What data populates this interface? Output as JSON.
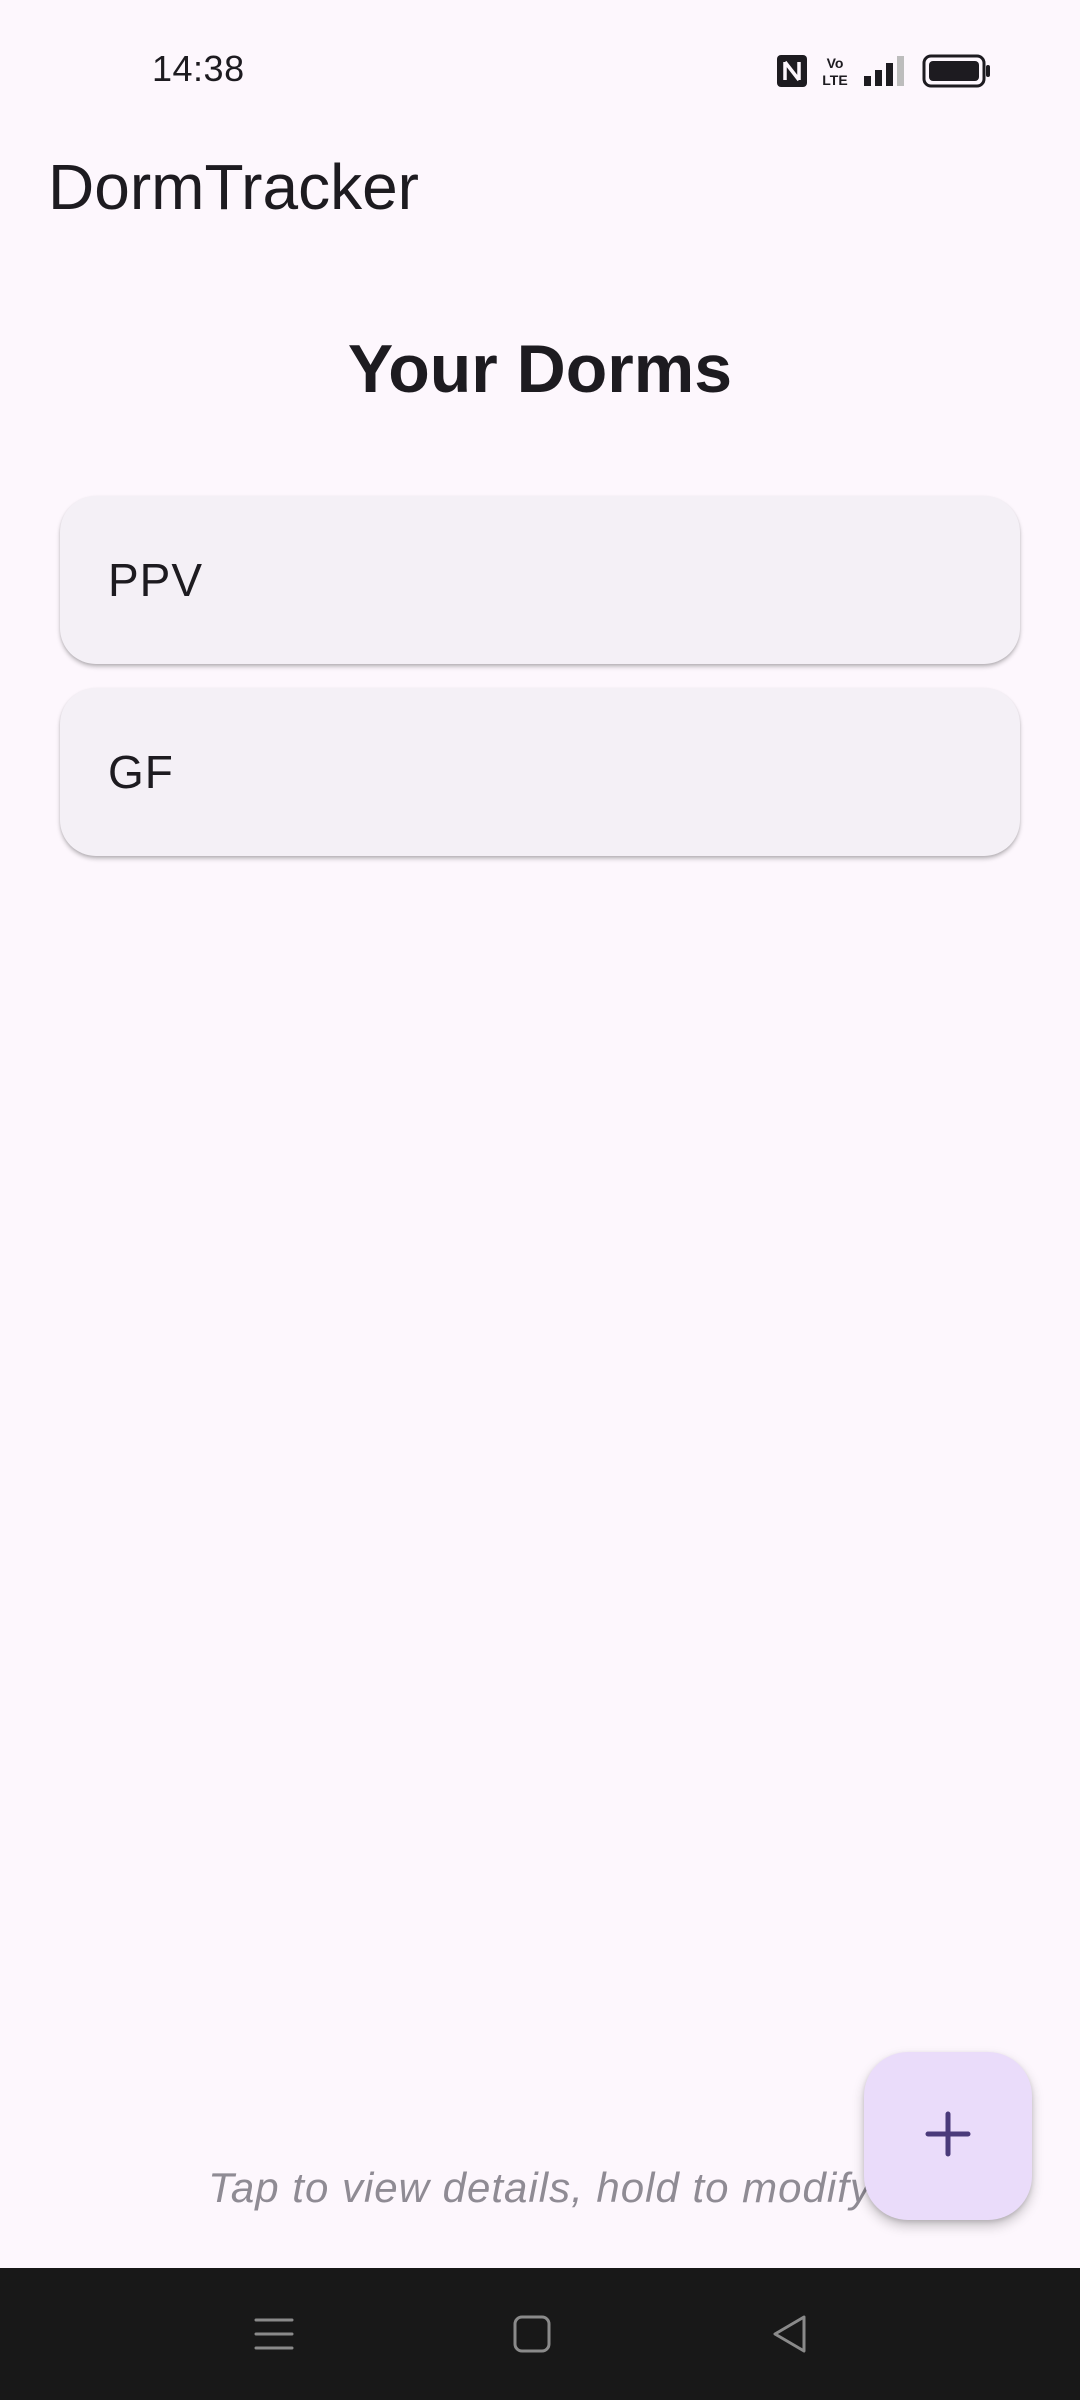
{
  "status_bar": {
    "time": "14:38",
    "icons": [
      "nfc-icon",
      "volte-icon",
      "signal-icon",
      "battery-icon"
    ],
    "volte_top": "Vo",
    "volte_bottom": "LTE"
  },
  "app": {
    "title": "DormTracker"
  },
  "main": {
    "heading": "Your Dorms",
    "dorms": [
      {
        "label": "PPV"
      },
      {
        "label": "GF"
      }
    ],
    "hint": "Tap to view details, hold to modify"
  },
  "fab": {
    "icon": "plus-icon",
    "color": "#eadcfa",
    "icon_color": "#4a3a7a"
  },
  "nav_bar": {
    "buttons": [
      "menu-icon",
      "home-icon",
      "back-icon"
    ]
  },
  "colors": {
    "background": "#fdf7fd",
    "card": "#f4f0f6",
    "hint": "#8f8b94",
    "nav_bar": "#181818"
  }
}
